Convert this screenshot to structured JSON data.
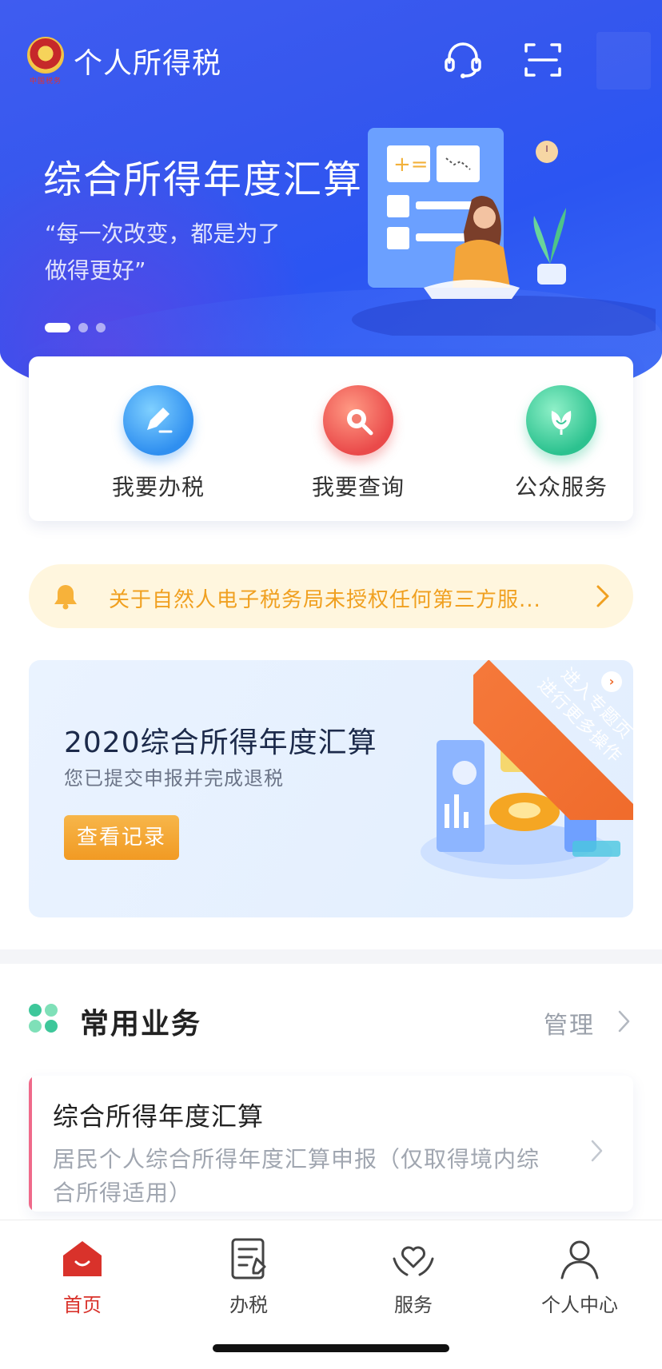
{
  "header": {
    "app_title": "个人所得税",
    "emblem_caption": "中国税务"
  },
  "banner": {
    "title": "综合所得年度汇算",
    "quote_line1": "“每一次改变，都是为了",
    "quote_line2": "做得更好”",
    "dots": 3,
    "active_dot": 0
  },
  "quick_actions": [
    {
      "label": "我要办税",
      "icon": "pencil-icon",
      "color": "#2f8ff0"
    },
    {
      "label": "我要查询",
      "icon": "search-icon",
      "color": "#ea4a4a"
    },
    {
      "label": "公众服务",
      "icon": "flower-icon",
      "color": "#2cc28f"
    }
  ],
  "notice": {
    "text": "关于自然人电子税务局未授权任何第三方服...",
    "color": "#f0a020"
  },
  "annual": {
    "title": "2020综合所得年度汇算",
    "subtitle": "您已提交申报并完成退税",
    "button": "查看记录",
    "ribbon_line1": "进入专题页",
    "ribbon_line2": "进行更多操作"
  },
  "common": {
    "title": "常用业务",
    "manage": "管理",
    "services": [
      {
        "title": "综合所得年度汇算",
        "desc": "居民个人综合所得年度汇算申报（仅取得境内综合所得适用）"
      }
    ]
  },
  "tabbar": {
    "tabs": [
      {
        "label": "首页",
        "icon": "home-icon",
        "active": true
      },
      {
        "label": "办税",
        "icon": "document-icon",
        "active": false
      },
      {
        "label": "服务",
        "icon": "heart-hands-icon",
        "active": false
      },
      {
        "label": "个人中心",
        "icon": "person-icon",
        "active": false
      }
    ],
    "active_color": "#d9322b"
  }
}
